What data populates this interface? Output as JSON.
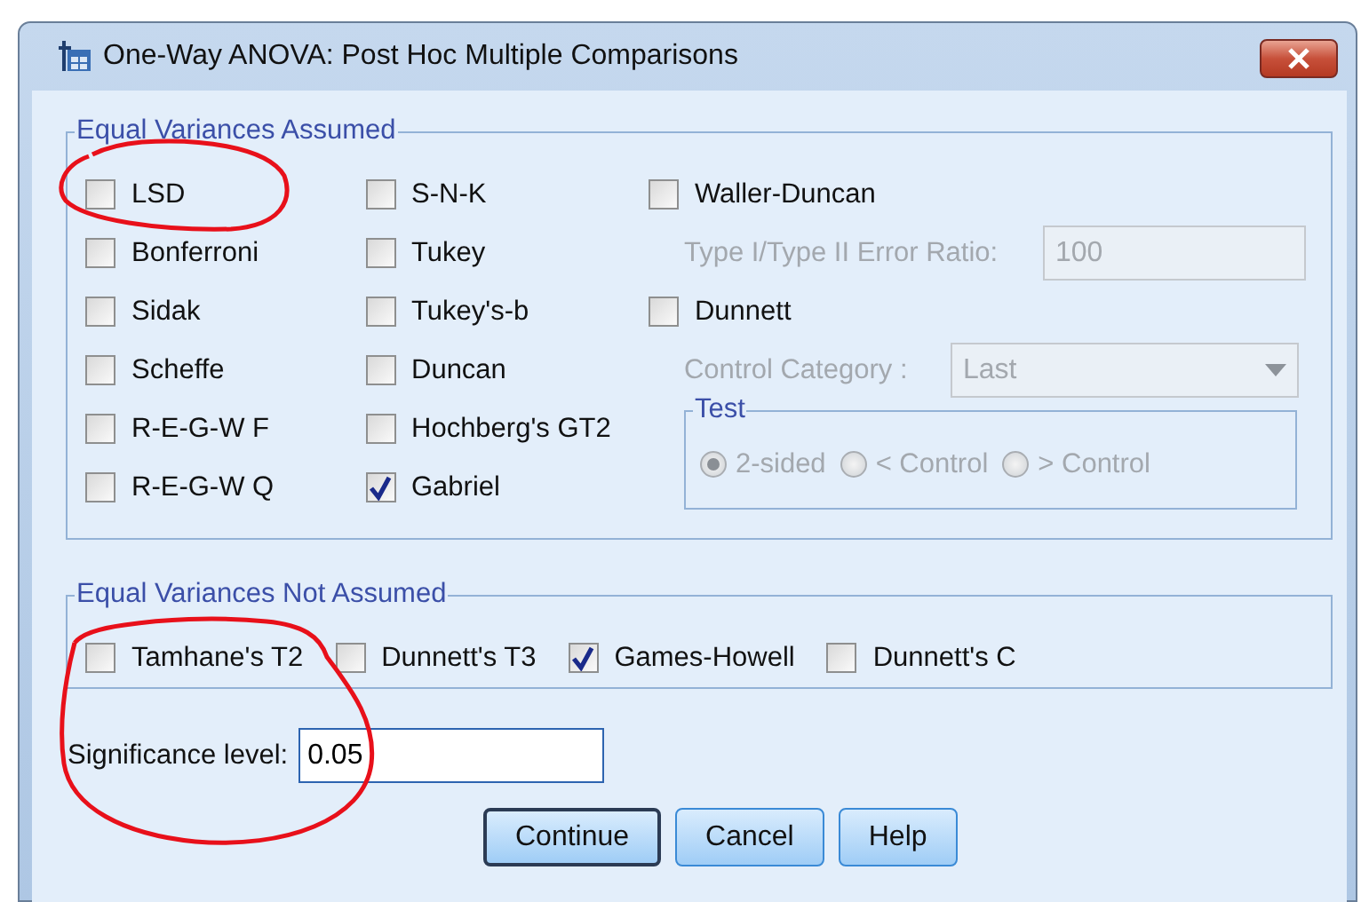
{
  "window": {
    "title": "One-Way ANOVA: Post Hoc Multiple Comparisons"
  },
  "equal_variances_assumed": {
    "title": "Equal Variances Assumed",
    "column_1": [
      {
        "label": "LSD",
        "checked": false
      },
      {
        "label": "Bonferroni",
        "checked": false
      },
      {
        "label": "Sidak",
        "checked": false
      },
      {
        "label": "Scheffe",
        "checked": false
      },
      {
        "label": "R-E-G-W F",
        "checked": false
      },
      {
        "label": "R-E-G-W Q",
        "checked": false
      }
    ],
    "column_2": [
      {
        "label": "S-N-K",
        "checked": false
      },
      {
        "label": "Tukey",
        "checked": false
      },
      {
        "label": "Tukey's-b",
        "checked": false
      },
      {
        "label": "Duncan",
        "checked": false
      },
      {
        "label": "Hochberg's GT2",
        "checked": false
      },
      {
        "label": "Gabriel",
        "checked": true
      }
    ],
    "waller_duncan": {
      "label": "Waller-Duncan",
      "checked": false
    },
    "error_ratio": {
      "label": "Type I/Type II Error Ratio:",
      "value": "100",
      "disabled": true
    },
    "dunnett": {
      "label": "Dunnett",
      "checked": false
    },
    "control_category": {
      "label": "Control Category :",
      "value": "Last",
      "disabled": true
    },
    "test": {
      "title": "Test",
      "options": [
        {
          "label": "2-sided",
          "selected": true,
          "disabled": true
        },
        {
          "label": "< Control",
          "selected": false,
          "disabled": true
        },
        {
          "label": "> Control",
          "selected": false,
          "disabled": true
        }
      ]
    }
  },
  "equal_variances_not_assumed": {
    "title": "Equal Variances Not Assumed",
    "options": [
      {
        "label": "Tamhane's T2",
        "checked": false
      },
      {
        "label": "Dunnett's T3",
        "checked": false
      },
      {
        "label": "Games-Howell",
        "checked": true
      },
      {
        "label": "Dunnett's C",
        "checked": false
      }
    ]
  },
  "significance_level": {
    "label": "Significance level:",
    "value": "0.05"
  },
  "buttons": [
    {
      "label": "Continue",
      "default": true
    },
    {
      "label": "Cancel",
      "default": false
    },
    {
      "label": "Help",
      "default": false
    }
  ]
}
